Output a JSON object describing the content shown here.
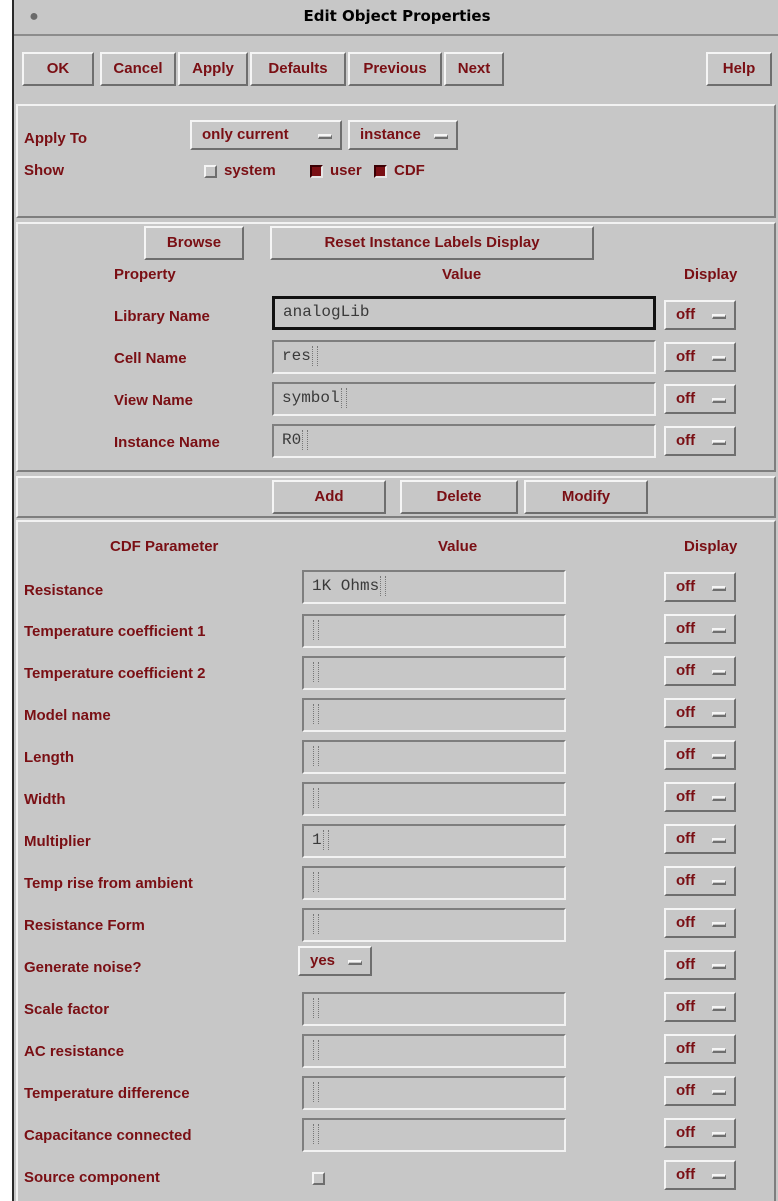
{
  "window": {
    "title": "Edit Object Properties",
    "icon": "window-menu-icon"
  },
  "toolbar": {
    "ok": "OK",
    "cancel": "Cancel",
    "apply": "Apply",
    "defaults": "Defaults",
    "previous": "Previous",
    "next": "Next",
    "help": "Help"
  },
  "apply_to": {
    "label": "Apply To",
    "scope": "only current",
    "object": "instance"
  },
  "show": {
    "label": "Show",
    "system": {
      "label": "system",
      "checked": false
    },
    "user": {
      "label": "user",
      "checked": true
    },
    "cdf": {
      "label": "CDF",
      "checked": true
    }
  },
  "properties": {
    "browse": "Browse",
    "reset": "Reset Instance Labels Display",
    "col_property": "Property",
    "col_value": "Value",
    "col_display": "Display",
    "rows": [
      {
        "name": "Library Name",
        "value": "analogLib",
        "display": "off"
      },
      {
        "name": "Cell Name",
        "value": "res",
        "display": "off"
      },
      {
        "name": "View Name",
        "value": "symbol",
        "display": "off"
      },
      {
        "name": "Instance Name",
        "value": "R0",
        "display": "off"
      }
    ]
  },
  "actions": {
    "add": "Add",
    "delete": "Delete",
    "modify": "Modify"
  },
  "cdf": {
    "col_param": "CDF Parameter",
    "col_value": "Value",
    "col_display": "Display",
    "rows": [
      {
        "name": "Resistance",
        "value": "1K Ohms",
        "display": "off"
      },
      {
        "name": "Temperature coefficient 1",
        "value": "",
        "display": "off"
      },
      {
        "name": "Temperature coefficient 2",
        "value": "",
        "display": "off"
      },
      {
        "name": "Model name",
        "value": "",
        "display": "off"
      },
      {
        "name": "Length",
        "value": "",
        "display": "off"
      },
      {
        "name": "Width",
        "value": "",
        "display": "off"
      },
      {
        "name": "Multiplier",
        "value": "1",
        "display": "off"
      },
      {
        "name": "Temp rise from ambient",
        "value": "",
        "display": "off"
      },
      {
        "name": "Resistance Form",
        "value": "",
        "display": "off"
      },
      {
        "name": "Generate noise?",
        "value": "yes",
        "display": "off"
      },
      {
        "name": "Scale factor",
        "value": "",
        "display": "off"
      },
      {
        "name": "AC resistance",
        "value": "",
        "display": "off"
      },
      {
        "name": "Temperature difference",
        "value": "",
        "display": "off"
      },
      {
        "name": "Capacitance connected",
        "value": "",
        "display": "off"
      },
      {
        "name": "Source component",
        "value": "",
        "display": "off"
      }
    ]
  },
  "colors": {
    "label": "#7a0f14",
    "background": "#c7c7c7"
  }
}
